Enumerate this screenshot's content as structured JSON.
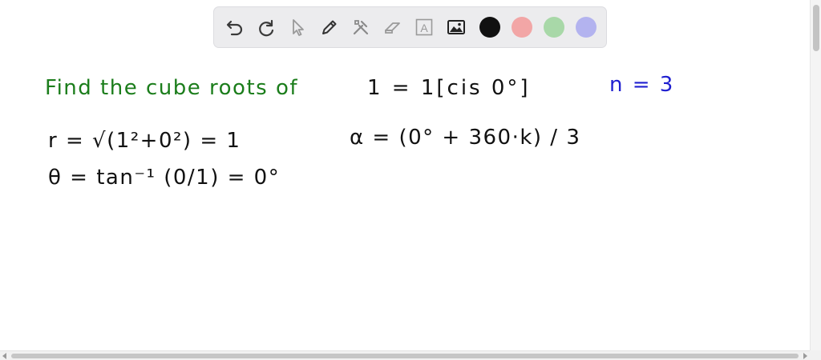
{
  "toolbar": {
    "tools": [
      {
        "name": "undo-icon",
        "label": "Undo"
      },
      {
        "name": "redo-icon",
        "label": "Redo"
      },
      {
        "name": "select-pointer-icon",
        "label": "Select"
      },
      {
        "name": "pen-icon",
        "label": "Pen"
      },
      {
        "name": "tools-icon",
        "label": "Tools"
      },
      {
        "name": "eraser-icon",
        "label": "Eraser"
      },
      {
        "name": "text-icon",
        "label": "A"
      },
      {
        "name": "image-icon",
        "label": "Image"
      }
    ],
    "colors": [
      {
        "name": "color-black",
        "hex": "#111111"
      },
      {
        "name": "color-pink",
        "hex": "#f2a6a6"
      },
      {
        "name": "color-green",
        "hex": "#a8d8a8"
      },
      {
        "name": "color-blue",
        "hex": "#b3b3ef"
      }
    ]
  },
  "handwriting": {
    "line1_green": "Find the cube roots of",
    "line1_black": "1 = 1[cis 0°]",
    "line1_blue": "n = 3",
    "line2": "r = √(1²+0²) = 1",
    "line2_alpha": "α = (0° + 360·k) / 3",
    "line3": "θ = tan⁻¹ (0/1) = 0°"
  },
  "ink_colors": {
    "green": "#1b7d1b",
    "blue": "#1f1fd0",
    "black": "#111111"
  }
}
